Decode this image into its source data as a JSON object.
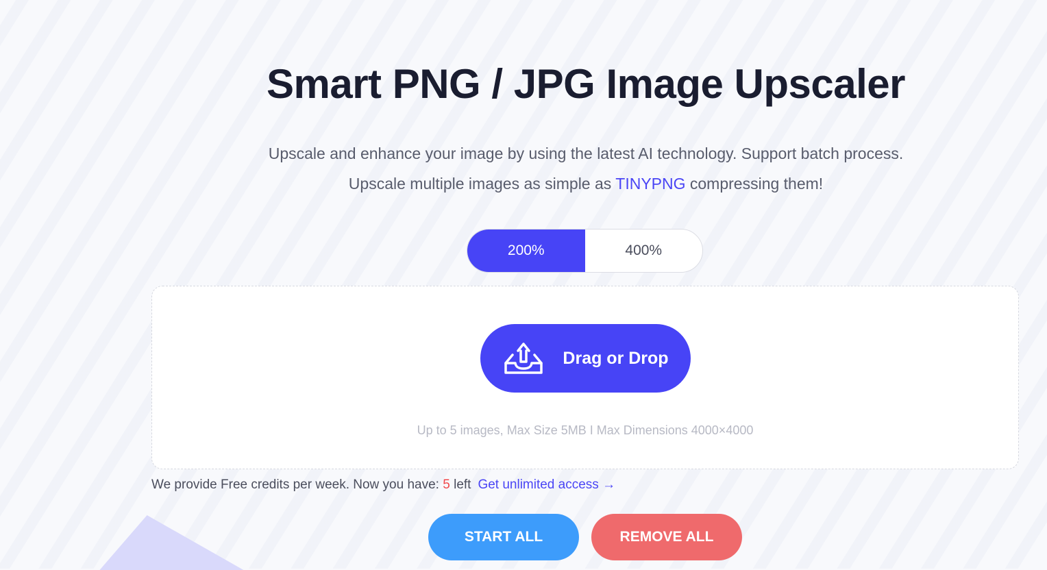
{
  "page": {
    "title": "Smart PNG / JPG Image Upscaler",
    "subtitle_part1": "Upscale and enhance your image by using the latest AI technology. Support batch process. Upscale multiple images as simple as ",
    "subtitle_link": "TINYPNG",
    "subtitle_part2": " compressing them!"
  },
  "scale_toggle": {
    "options": [
      "200%",
      "400%"
    ],
    "selected": "200%"
  },
  "dropzone": {
    "button_label": "Drag or Drop",
    "button_icon": "upload-tray-icon",
    "limits_text": "Up to 5 images, Max Size 5MB I Max Dimensions 4000×4000"
  },
  "credits": {
    "text_before": "We provide Free credits per week. Now you have: ",
    "count": "5",
    "text_after": " left",
    "upgrade_link": "Get unlimited access →"
  },
  "actions": {
    "start_label": "START ALL",
    "remove_label": "REMOVE ALL"
  },
  "colors": {
    "accent": "#4744f6",
    "start": "#3d9cfb",
    "remove": "#ef6a6c",
    "credit_count": "#f0484b"
  }
}
